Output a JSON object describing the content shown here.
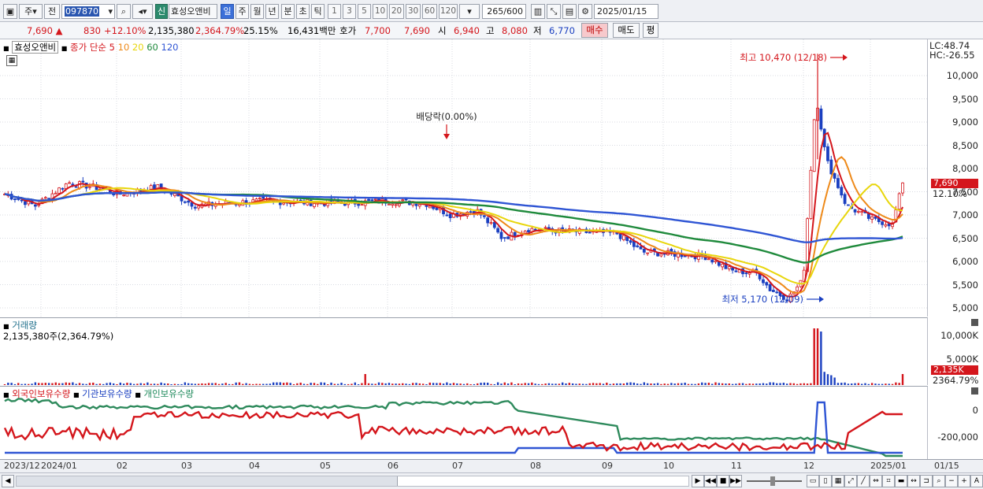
{
  "toolbar": {
    "period_main": "주",
    "prefix": "전",
    "code": "097870",
    "new_badge": "신",
    "stock_name": "효성오앤비",
    "periods": [
      "일",
      "주",
      "월",
      "년",
      "분",
      "초",
      "틱"
    ],
    "active_period": "일",
    "minutes": [
      "1",
      "3",
      "5",
      "10",
      "20",
      "30",
      "60",
      "120"
    ],
    "count": "265",
    "count_total": "/600",
    "date": "2025/01/15"
  },
  "quote": {
    "price": "7,690",
    "change": "830",
    "change_pct": "+12.10%",
    "volume": "2,135,380",
    "volume_pct": "2,364.79%",
    "turnover_pct": "25.15%",
    "amount": "16,431백만",
    "ask_label": "호가",
    "ask": "7,700",
    "bid": "7,690",
    "open_label": "시",
    "open": "6,940",
    "high_label": "고",
    "high": "8,080",
    "low_label": "저",
    "low": "6,770",
    "buy": "매수",
    "sell": "매도",
    "flat": "평"
  },
  "price_panel": {
    "stock": "효성오앤비",
    "ma_label": "종가 단순",
    "ma_periods": [
      "5",
      "10",
      "20",
      "60",
      "120"
    ],
    "ma_colors": [
      "#d4161c",
      "#ee8a1a",
      "#e8d60c",
      "#1f8a3c",
      "#2f55d4"
    ],
    "lc": "LC:48.74",
    "hc": "HC:-26.55",
    "high_note": "최고 10,470 (12/18)",
    "low_note": "최저 5,170 (12/09)",
    "dividend_note": "배당락(0.00%)",
    "current_price": "7,690",
    "current_pct": "12.10%",
    "y_ticks": [
      "10,000",
      "9,500",
      "9,000",
      "8,500",
      "8,000",
      "7,500",
      "7,000",
      "6,500",
      "6,000",
      "5,500",
      "5,000"
    ]
  },
  "volume_panel": {
    "title": "거래량",
    "value": "2,135,380주(2,364.79%)",
    "y_ticks": [
      "10,000K",
      "5,000K"
    ],
    "current": "2,135K",
    "current_pct": "2364.79%"
  },
  "holding_panel": {
    "foreign": "외국인보유수량",
    "institution": "기관보유수량",
    "individual": "개인보유수량",
    "y_ticks": [
      "0",
      "-200,000"
    ]
  },
  "date_axis": {
    "labels": [
      "2023/12",
      "2024/01",
      "02",
      "03",
      "04",
      "05",
      "06",
      "07",
      "08",
      "09",
      "10",
      "11",
      "12",
      "2025/01",
      "01/15"
    ]
  },
  "chart_data": {
    "type": "candlestick",
    "y_range": [
      5000,
      10470
    ],
    "series_levels": {
      "high": 10470,
      "high_date": "12/18",
      "low": 5170,
      "low_date": "12/09",
      "last": 7690
    }
  }
}
